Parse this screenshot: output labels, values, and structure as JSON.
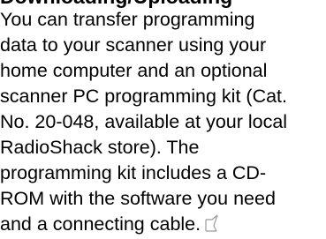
{
  "heading": "Downloading/Uploading",
  "paragraph": {
    "lines": [
      "You can transfer programming",
      "data to your scanner using your",
      "home computer and an optional",
      "scanner PC programming kit (Cat.",
      "No. 20-048, available at your local",
      "RadioShack store). The",
      "programming kit includes a CD-",
      "ROM with the software you need",
      "and a connecting cable."
    ]
  },
  "icons": {
    "end_mark": "end-of-section-mark-icon"
  }
}
